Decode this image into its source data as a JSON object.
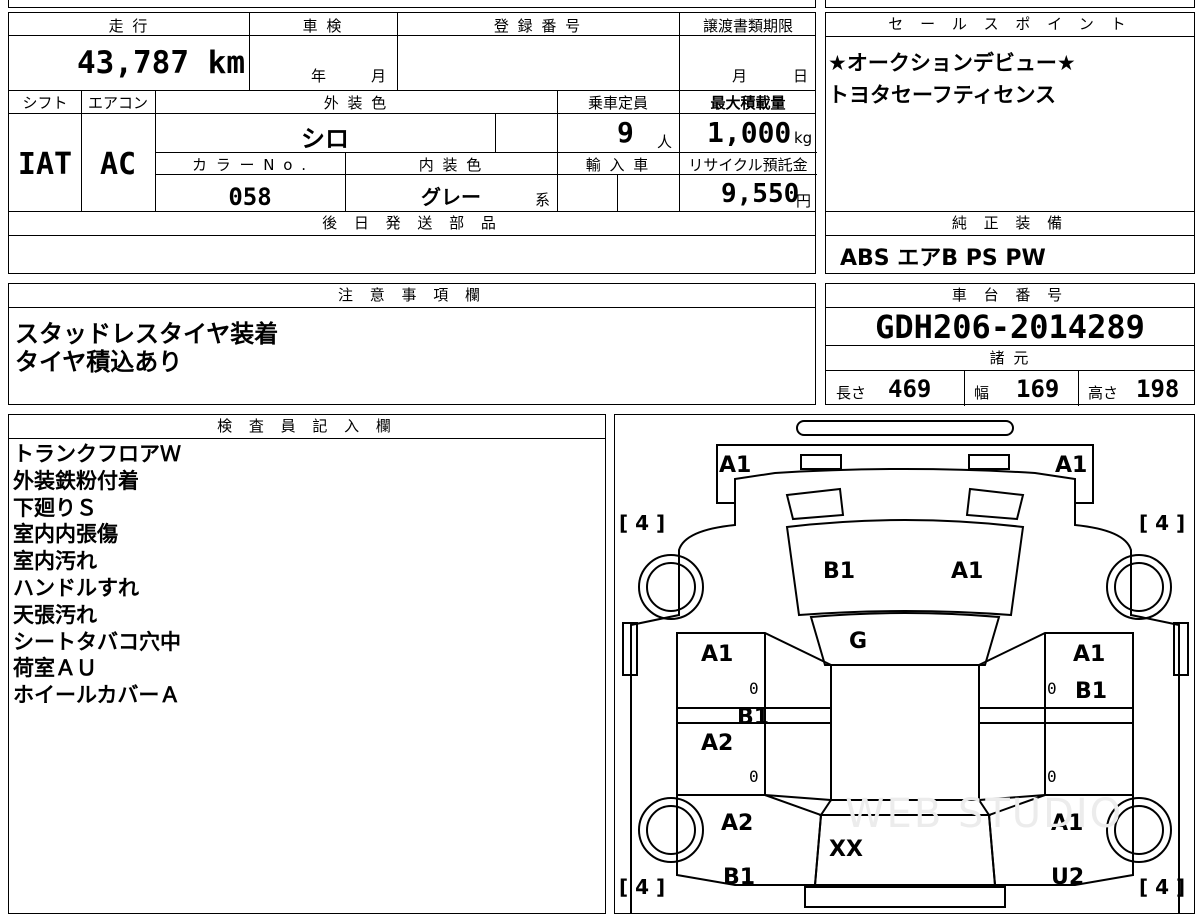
{
  "vehicle": {
    "mileage_label": "走 行",
    "mileage": "43,787",
    "mileage_unit": "km",
    "inspection_label": "車 検",
    "inspection_year_unit": "年",
    "inspection_month_unit": "月",
    "registration_label": "登 録 番 号",
    "transfer_deadline_label": "譲渡書類期限",
    "transfer_month_unit": "月",
    "transfer_day_unit": "日",
    "shift_label": "シフト",
    "shift": "IAT",
    "ac_label": "エアコン",
    "ac": "AC",
    "exterior_color_label": "外 装 色",
    "exterior_color": "シロ",
    "capacity_label": "乗車定員",
    "capacity": "9",
    "capacity_unit": "人",
    "max_load_label": "最大積載量",
    "max_load": "1,000",
    "max_load_unit": "kg",
    "color_no_label": "カ ラ ー N o .",
    "color_no": "058",
    "interior_color_label": "内 装 色",
    "interior_color": "グレー",
    "interior_color_suffix": "系",
    "import_label": "輸 入 車",
    "recycle_fee_label": "リサイクル預託金",
    "recycle_fee": "9,550",
    "recycle_fee_unit": "円",
    "later_parts_label": "後 日 発 送 部 品",
    "notes_label": "注 意 事 項 欄",
    "notes": [
      "スタッドレスタイヤ装着",
      "タイヤ積込あり"
    ]
  },
  "sales": {
    "label": "セ ー ル ス ポ イ ン ト",
    "points": [
      "★オークションデビュー★",
      "トヨタセーフティセンス"
    ]
  },
  "equipment": {
    "label": "純 正 装 備",
    "items": "ABS エアB PS PW"
  },
  "chassis": {
    "label": "車 台 番 号",
    "number": "GDH206-2014289",
    "spec_label": "諸 元",
    "length_label": "長さ",
    "length": "469",
    "width_label": "幅",
    "width": "169",
    "height_label": "高さ",
    "height": "198"
  },
  "inspector": {
    "label": "検 査 員 記 入 欄",
    "lines": [
      "トランクフロアＷ",
      "外装鉄粉付着",
      "下廻りＳ",
      "室内内張傷",
      "室内汚れ",
      "ハンドルすれ",
      "天張汚れ",
      "シートタバコ穴中",
      "荷室ＡＵ",
      "ホイールカバーＡ"
    ]
  },
  "diagram": {
    "tire_left_top": "[ 4 ]",
    "tire_right_top": "[ 4 ]",
    "tire_left_bottom": "[ 4 ]",
    "tire_right_bottom": "[ 4 ]",
    "front_left": "A1",
    "front_right": "A1",
    "hood_left": "B1",
    "hood_right": "A1",
    "windshield": "G",
    "left_front_door": "A1",
    "left_front_door_zero": "0",
    "left_mid": "B1",
    "left_rear_door": "A2",
    "left_rear_door_zero": "0",
    "right_front_door": "A1",
    "right_front_door_zero": "0",
    "right_mid": "B1",
    "right_rear_door_zero": "0",
    "left_rear_quarter": "A2",
    "left_rear_bottom": "B1",
    "rear": "XX",
    "right_rear_quarter": "A1",
    "right_rear_bottom": "U2",
    "watermark": "WEB STUDIO"
  }
}
